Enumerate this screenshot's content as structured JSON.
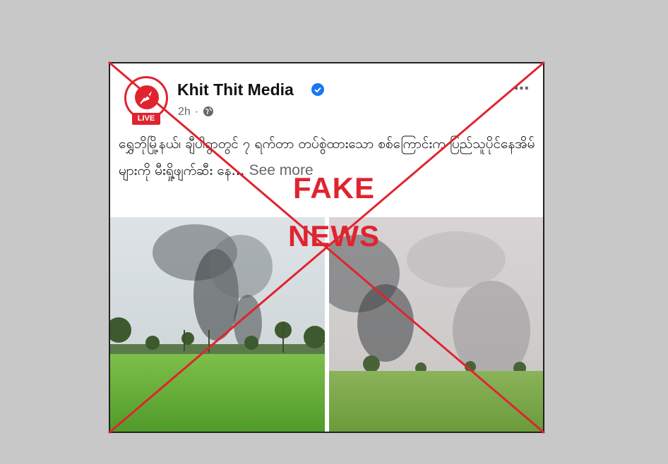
{
  "post": {
    "page_name": "Khit Thit Media",
    "live_badge": "LIVE",
    "time": "2h",
    "separator": "·",
    "text": "ရွှေဘိုမြို့နယ်၊ ချီပါရွာတွင် ၇ ရက်တာ တပ်စွဲထားသော စစ်ကြောင်းက ပြည်သူပိုင်နေအိမ်များကို မီးရှို့ဖျက်ဆီး နေ…",
    "see_more": "See more",
    "more_menu": "..."
  },
  "overlay": {
    "line1": "FAKE",
    "line2": "NEWS",
    "color": "#e0242f"
  },
  "icons": {
    "verified": "verified-badge-icon",
    "globe": "globe-icon",
    "avatar": "khit-thit-logo"
  },
  "colors": {
    "background": "#c8c8c8",
    "brand_red": "#e0242f",
    "verified_blue": "#1877f2",
    "meta_gray": "#65676b"
  }
}
